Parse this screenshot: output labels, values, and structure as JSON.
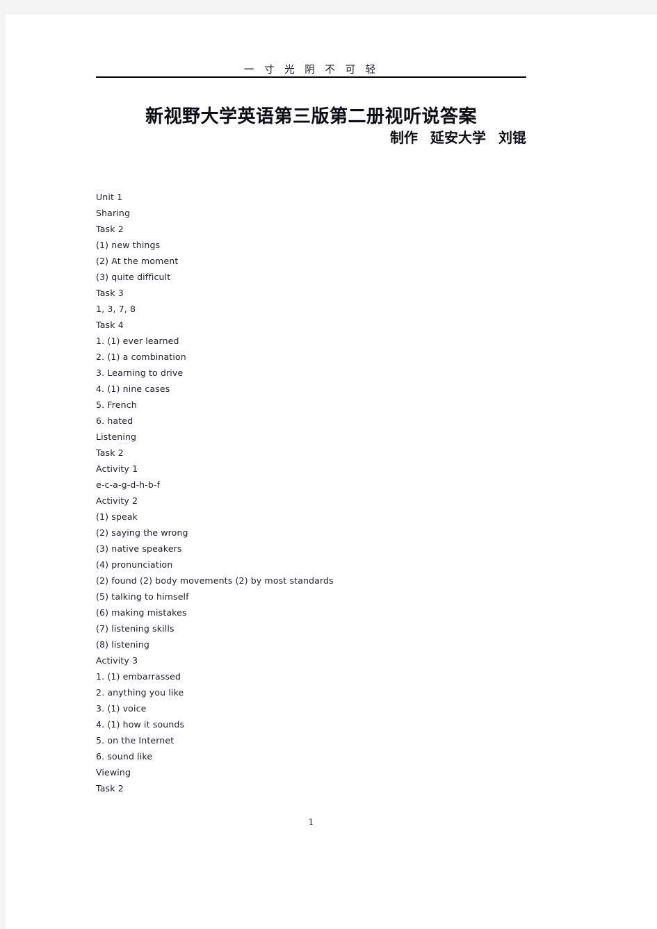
{
  "page": {
    "running_header": "一 寸 光 阴 不 可 轻",
    "title": "新视野大学英语第三版第二册视听说答案",
    "byline": {
      "role": "制作",
      "affiliation": "延安大学",
      "author": "刘锟"
    },
    "page_number": "1",
    "colors": {
      "canvas": "#f4f4f4",
      "paper": "#ffffff",
      "text": "#1d1d2c",
      "rule": "#000000"
    }
  },
  "answers": {
    "lines": [
      "Unit 1",
      "Sharing",
      "Task 2",
      "(1) new things",
      "(2) At the moment",
      "(3) quite difficult",
      "Task 3",
      "1, 3, 7, 8",
      "Task 4",
      "1. (1) ever learned",
      "2. (1) a combination",
      "3. Learning to drive",
      "4. (1) nine cases",
      "5. French",
      "6. hated",
      "Listening",
      "Task 2",
      "Activity 1",
      "e-c-a-g-d-h-b-f",
      "Activity 2",
      "(1) speak",
      "(2) saying the wrong",
      "(3) native speakers",
      "(4) pronunciation",
      "(2) found (2) body movements (2) by most standards",
      "(5) talking to himself",
      "(6) making mistakes",
      "(7) listening skills",
      "(8) listening",
      "Activity 3",
      "1. (1) embarrassed",
      "2. anything you like",
      "3. (1) voice",
      "4. (1) how it sounds",
      "5. on the Internet",
      "6. sound like",
      "Viewing",
      "Task 2"
    ]
  }
}
